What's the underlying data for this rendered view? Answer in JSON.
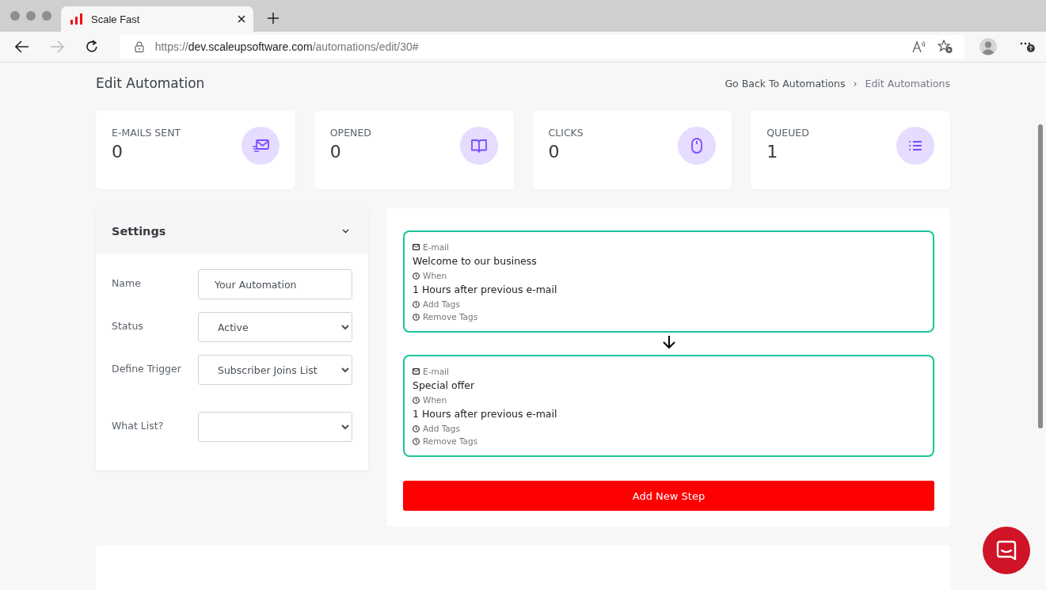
{
  "browser": {
    "tab_title": "Scale Fast",
    "url_scheme": "https://",
    "url_host": "dev.scaleupsoftware.com",
    "url_path": "/automations/edit/30#"
  },
  "page": {
    "title": "Edit Automation",
    "breadcrumb": [
      {
        "label": "Go Back To Automations",
        "kind": "link"
      },
      {
        "label": "Edit Automations",
        "kind": "current"
      }
    ],
    "breadcrumb_separator": "›"
  },
  "stats": [
    {
      "label": "E-MAILS SENT",
      "value": "0",
      "kind": "mail"
    },
    {
      "label": "OPENED",
      "value": "0",
      "kind": "book"
    },
    {
      "label": "CLICKS",
      "value": "0",
      "kind": "mouse"
    },
    {
      "label": "QUEUED",
      "value": "1",
      "kind": "list"
    }
  ],
  "settings": {
    "title": "Settings",
    "expanded": true,
    "fields": [
      {
        "label": "Name",
        "kind": "input",
        "value": "Your Automation"
      },
      {
        "label": "Status",
        "kind": "select",
        "value": "Active"
      },
      {
        "label": "Define Trigger",
        "kind": "select",
        "value": "Subscriber Joins List"
      },
      {
        "label": "What List?",
        "kind": "select"
      }
    ]
  },
  "steps": [
    {
      "type_label": "E-mail",
      "subject": "Welcome to our business",
      "when_label": "When",
      "delay": "1 Hours after previous e-mail",
      "add_tags": "Add Tags",
      "remove_tags": "Remove Tags"
    },
    {
      "type_label": "E-mail",
      "subject": "Special offer",
      "when_label": "When",
      "delay": "1 Hours after previous e-mail",
      "add_tags": "Add Tags",
      "remove_tags": "Remove Tags"
    }
  ],
  "add_step_button": "Add New Step"
}
